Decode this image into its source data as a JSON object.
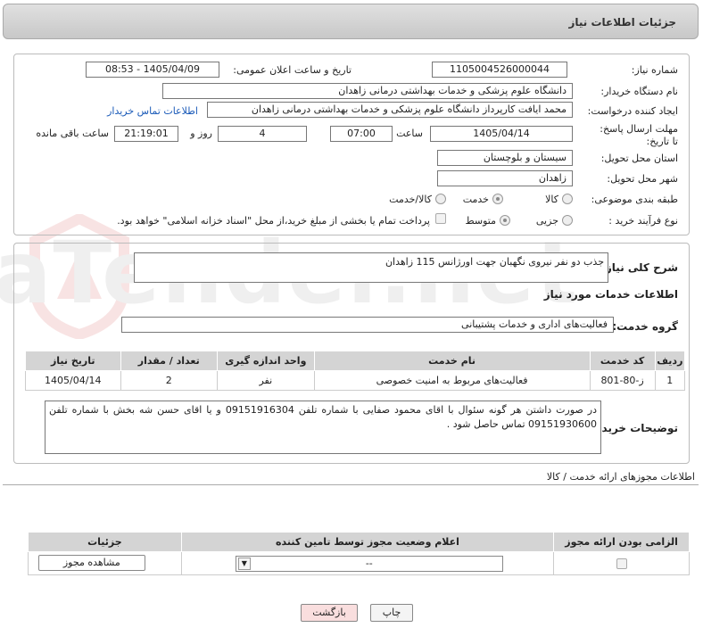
{
  "header": {
    "title": "جزئیات اطلاعات نیاز"
  },
  "form": {
    "need_number_label": "شماره نیاز:",
    "need_number": "1105004526000044",
    "announce_label": "تاریخ و ساعت اعلان عمومی:",
    "announce_value": "1405/04/09 - 08:53",
    "buyer_org_label": "نام دستگاه خریدار:",
    "buyer_org": "دانشگاه علوم پزشکی و خدمات بهداشتی درمانی زاهدان",
    "creator_label": "ایجاد کننده درخواست:",
    "creator": "محمد ایافت کارپرداز دانشگاه علوم پزشکی و خدمات بهداشتی درمانی زاهدان",
    "buyer_contact_link": "اطلاعات تماس خریدار",
    "deadline_label": "مهلت ارسال پاسخ: تا تاریخ:",
    "deadline_date": "1405/04/14",
    "time_label": "ساعت",
    "deadline_time": "07:00",
    "days_value": "4",
    "days_label": "روز و",
    "remaining_time": "21:19:01",
    "remaining_label": "ساعت باقی مانده",
    "province_label": "استان محل تحویل:",
    "province": "سیستان و بلوچستان",
    "city_label": "شهر محل تحویل:",
    "city": "زاهدان",
    "category_label": "طبقه بندی موضوعی:",
    "category_options": [
      "کالا",
      "خدمت",
      "کالا/خدمت"
    ],
    "category_selected": "خدمت",
    "process_label": "نوع فرآیند خرید :",
    "process_options": [
      "جزیی",
      "متوسط"
    ],
    "process_selected": "متوسط",
    "payment_note": "پرداخت تمام یا بخشی از مبلغ خرید،از محل \"اسناد خزانه اسلامی\" خواهد بود."
  },
  "details": {
    "summary_label": "شرح کلی نیاز:",
    "summary": "جذب دو نفر نیروی نگهبان جهت اورژانس 115 زاهدان",
    "services_title": "اطلاعات خدمات مورد نیاز",
    "service_group_label": "گروه خدمت:",
    "service_group": "فعالیت‌های اداری و خدمات پشتیبانی",
    "table": {
      "headers": [
        "ردیف",
        "کد خدمت",
        "نام خدمت",
        "واحد اندازه گیری",
        "تعداد / مقدار",
        "تاریخ نیاز"
      ],
      "rows": [
        [
          "1",
          "ز-80-801",
          "فعالیت‌های مربوط به امنیت خصوصی",
          "نفر",
          "2",
          "1405/04/14"
        ]
      ]
    },
    "buyer_notes_label": "توضیحات خریدار:",
    "buyer_notes": "در صورت داشتن هر گونه سئوال با اقای محمود صفایی با شماره تلفن 09151916304 و یا اقای حسن شه بخش با شماره تلفن 09151930600 تماس حاصل شود ."
  },
  "permits": {
    "section_title": "اطلاعات مجوزهای ارائه خدمت / کالا",
    "headers": [
      "الزامی بودن ارائه مجوز",
      "اعلام وضعیت مجوز توسط تامین کننده",
      "جزئیات"
    ],
    "status_value": "--",
    "view_button": "مشاهده مجوز"
  },
  "actions": {
    "print": "چاپ",
    "back": "بازگشت"
  },
  "watermark": {
    "text": "AriaTender.net"
  }
}
